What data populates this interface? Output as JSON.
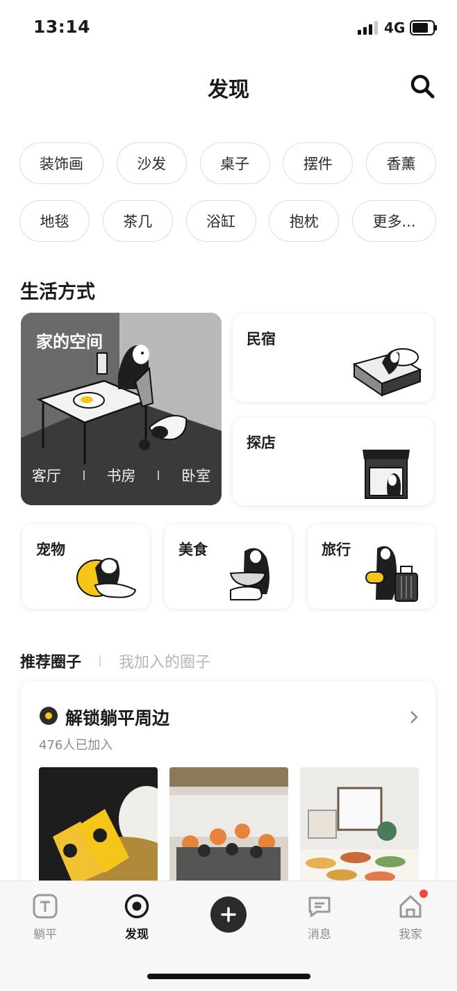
{
  "status_bar": {
    "time": "13:14",
    "network": "4G"
  },
  "header": {
    "title": "发现",
    "search_icon": "search-icon"
  },
  "categories": {
    "row1": [
      "装饰画",
      "沙发",
      "桌子",
      "摆件",
      "香薰"
    ],
    "row2": [
      "地毯",
      "茶几",
      "浴缸",
      "抱枕",
      "更多..."
    ]
  },
  "lifestyle": {
    "title": "生活方式",
    "home_space": {
      "label": "家的空间",
      "rooms": [
        "客厅",
        "书房",
        "卧室"
      ]
    },
    "cards": {
      "homestay": "民宿",
      "shop_visit": "探店",
      "pets": "宠物",
      "food": "美食",
      "travel": "旅行"
    }
  },
  "circles": {
    "tab_recommended": "推荐圈子",
    "tab_joined": "我加入的圈子",
    "featured": {
      "title": "解锁躺平周边",
      "member_count": "476人已加入"
    }
  },
  "bottom_nav": {
    "items": [
      "躺平",
      "发现",
      "消息",
      "我家"
    ],
    "active": "发现"
  },
  "colors": {
    "accent_yellow": "#f5c518",
    "badge_red": "#f2453d",
    "dark": "#2b2b2b"
  }
}
